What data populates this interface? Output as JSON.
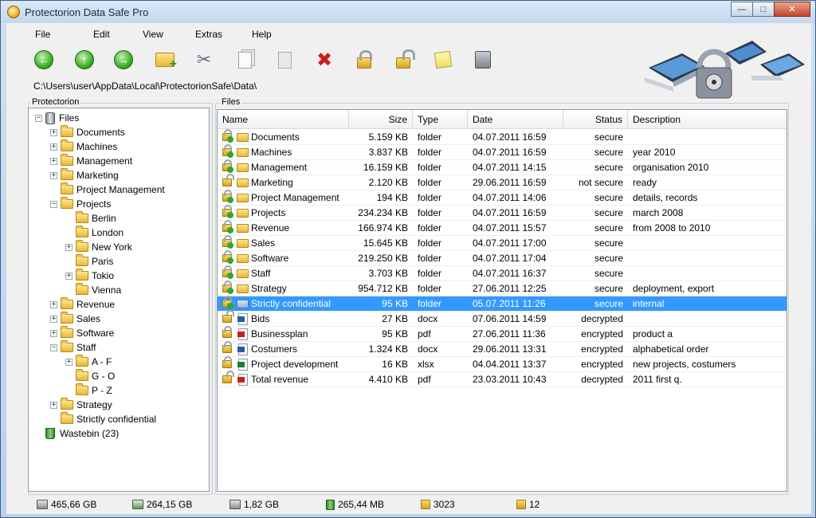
{
  "window": {
    "title": "Protectorion Data Safe Pro"
  },
  "menu": [
    "File",
    "Edit",
    "View",
    "Extras",
    "Help"
  ],
  "toolbar": [
    {
      "name": "back-button",
      "icon": "back-arrow-icon"
    },
    {
      "name": "up-button",
      "icon": "up-arrow-icon"
    },
    {
      "name": "forward-button",
      "icon": "forward-arrow-icon"
    },
    {
      "name": "new-folder-button",
      "icon": "new-folder-icon"
    },
    {
      "name": "cut-button",
      "icon": "scissors-icon"
    },
    {
      "name": "copy-button",
      "icon": "copy-icon"
    },
    {
      "name": "paste-button",
      "icon": "paste-icon"
    },
    {
      "name": "delete-button",
      "icon": "delete-icon"
    },
    {
      "name": "encrypt-button",
      "icon": "lock-icon"
    },
    {
      "name": "decrypt-button",
      "icon": "unlock-icon"
    },
    {
      "name": "notes-button",
      "icon": "note-icon"
    },
    {
      "name": "safe-button",
      "icon": "safe-icon"
    }
  ],
  "path": "C:\\Users\\user\\AppData\\Local\\ProtectorionSafe\\Data\\",
  "tree": {
    "label": "Protectorion",
    "items": [
      {
        "label": "Files",
        "depth": 0,
        "expander": "-",
        "icon": "db"
      },
      {
        "label": "Documents",
        "depth": 1,
        "expander": "+",
        "icon": "folder"
      },
      {
        "label": "Machines",
        "depth": 1,
        "expander": "+",
        "icon": "folder"
      },
      {
        "label": "Management",
        "depth": 1,
        "expander": "+",
        "icon": "folder"
      },
      {
        "label": "Marketing",
        "depth": 1,
        "expander": "+",
        "icon": "folder"
      },
      {
        "label": "Project Management",
        "depth": 1,
        "expander": "",
        "icon": "folder"
      },
      {
        "label": "Projects",
        "depth": 1,
        "expander": "-",
        "icon": "folder"
      },
      {
        "label": "Berlin",
        "depth": 2,
        "expander": "",
        "icon": "folder"
      },
      {
        "label": "London",
        "depth": 2,
        "expander": "",
        "icon": "folder"
      },
      {
        "label": "New York",
        "depth": 2,
        "expander": "+",
        "icon": "folder"
      },
      {
        "label": "Paris",
        "depth": 2,
        "expander": "",
        "icon": "folder"
      },
      {
        "label": "Tokio",
        "depth": 2,
        "expander": "+",
        "icon": "folder"
      },
      {
        "label": "Vienna",
        "depth": 2,
        "expander": "",
        "icon": "folder"
      },
      {
        "label": "Revenue",
        "depth": 1,
        "expander": "+",
        "icon": "folder"
      },
      {
        "label": "Sales",
        "depth": 1,
        "expander": "+",
        "icon": "folder"
      },
      {
        "label": "Software",
        "depth": 1,
        "expander": "+",
        "icon": "folder"
      },
      {
        "label": "Staff",
        "depth": 1,
        "expander": "-",
        "icon": "folder"
      },
      {
        "label": "A - F",
        "depth": 2,
        "expander": "+",
        "icon": "folder"
      },
      {
        "label": "G - O",
        "depth": 2,
        "expander": "",
        "icon": "folder"
      },
      {
        "label": "P - Z",
        "depth": 2,
        "expander": "",
        "icon": "folder"
      },
      {
        "label": "Strategy",
        "depth": 1,
        "expander": "+",
        "icon": "folder"
      },
      {
        "label": "Strictly confidential",
        "depth": 1,
        "expander": "",
        "icon": "folder"
      },
      {
        "label": "Wastebin (23)",
        "depth": 0,
        "expander": "",
        "icon": "bin"
      }
    ]
  },
  "files": {
    "label": "Files",
    "columns": [
      "Name",
      "Size",
      "Type",
      "Date",
      "Status",
      "Description"
    ],
    "rows": [
      {
        "name": "Documents",
        "size": "5.159 KB",
        "type": "folder",
        "date": "04.07.2011 16:59",
        "status": "secure",
        "description": "",
        "lock": "secure",
        "icon": "folder"
      },
      {
        "name": "Machines",
        "size": "3.837 KB",
        "type": "folder",
        "date": "04.07.2011 16:59",
        "status": "secure",
        "description": "year 2010",
        "lock": "secure",
        "icon": "folder"
      },
      {
        "name": "Management",
        "size": "16.159 KB",
        "type": "folder",
        "date": "04.07.2011 14:15",
        "status": "secure",
        "description": "organisation 2010",
        "lock": "secure",
        "icon": "folder"
      },
      {
        "name": "Marketing",
        "size": "2.120 KB",
        "type": "folder",
        "date": "29.06.2011 16:59",
        "status": "not secure",
        "description": "ready",
        "lock": "open",
        "icon": "folder"
      },
      {
        "name": "Project Management",
        "size": "194 KB",
        "type": "folder",
        "date": "04.07.2011 14:06",
        "status": "secure",
        "description": "details, records",
        "lock": "secure",
        "icon": "folder"
      },
      {
        "name": "Projects",
        "size": "234.234 KB",
        "type": "folder",
        "date": "04.07.2011 16:59",
        "status": "secure",
        "description": "march 2008",
        "lock": "secure",
        "icon": "folder"
      },
      {
        "name": "Revenue",
        "size": "166.974 KB",
        "type": "folder",
        "date": "04.07.2011 15:57",
        "status": "secure",
        "description": "from 2008 to 2010",
        "lock": "secure",
        "icon": "folder"
      },
      {
        "name": "Sales",
        "size": "15.645 KB",
        "type": "folder",
        "date": "04.07.2011 17:00",
        "status": "secure",
        "description": "",
        "lock": "secure",
        "icon": "folder"
      },
      {
        "name": "Software",
        "size": "219.250 KB",
        "type": "folder",
        "date": "04.07.2011 17:04",
        "status": "secure",
        "description": "",
        "lock": "secure",
        "icon": "folder"
      },
      {
        "name": "Staff",
        "size": "3.703 KB",
        "type": "folder",
        "date": "04.07.2011 16:37",
        "status": "secure",
        "description": "",
        "lock": "secure",
        "icon": "folder"
      },
      {
        "name": "Strategy",
        "size": "954.712 KB",
        "type": "folder",
        "date": "27.06.2011 12:25",
        "status": "secure",
        "description": "deployment, export",
        "lock": "secure",
        "icon": "folder"
      },
      {
        "name": "Strictly confidential",
        "size": "95 KB",
        "type": "folder",
        "date": "05.07.2011 11:26",
        "status": "secure",
        "description": "internal",
        "lock": "secure",
        "icon": "folder-blue",
        "selected": true
      },
      {
        "name": "Bids",
        "size": "27 KB",
        "type": "docx",
        "date": "07.06.2011 14:59",
        "status": "decrypted",
        "description": "",
        "lock": "open",
        "icon": "docx"
      },
      {
        "name": "Businessplan",
        "size": "95 KB",
        "type": "pdf",
        "date": "27.06.2011 11:36",
        "status": "encrypted",
        "description": "product a",
        "lock": "closed",
        "icon": "pdf"
      },
      {
        "name": "Costumers",
        "size": "1.324 KB",
        "type": "docx",
        "date": "29.06.2011 13:31",
        "status": "encrypted",
        "description": "alphabetical order",
        "lock": "closed",
        "icon": "docx"
      },
      {
        "name": "Project development",
        "size": "16 KB",
        "type": "xlsx",
        "date": "04.04.2011 13:37",
        "status": "encrypted",
        "description": "new projects, costumers",
        "lock": "closed",
        "icon": "xlsx"
      },
      {
        "name": "Total revenue",
        "size": "4.410 KB",
        "type": "pdf",
        "date": "23.03.2011 10:43",
        "status": "decrypted",
        "description": "2011 first q.",
        "lock": "open",
        "icon": "pdf"
      }
    ]
  },
  "status": [
    {
      "value": "465,66 GB",
      "icon": "hdd-icon"
    },
    {
      "value": "264,15 GB",
      "icon": "hdd-free-icon"
    },
    {
      "value": "1,82 GB",
      "icon": "database-icon"
    },
    {
      "value": "265,44 MB",
      "icon": "wastebin-icon"
    },
    {
      "value": "3023",
      "icon": "lock-icon"
    },
    {
      "value": "12",
      "icon": "unlock-icon"
    }
  ],
  "colors": {
    "selection": "#3399ff",
    "accent": "#3a5f87"
  }
}
